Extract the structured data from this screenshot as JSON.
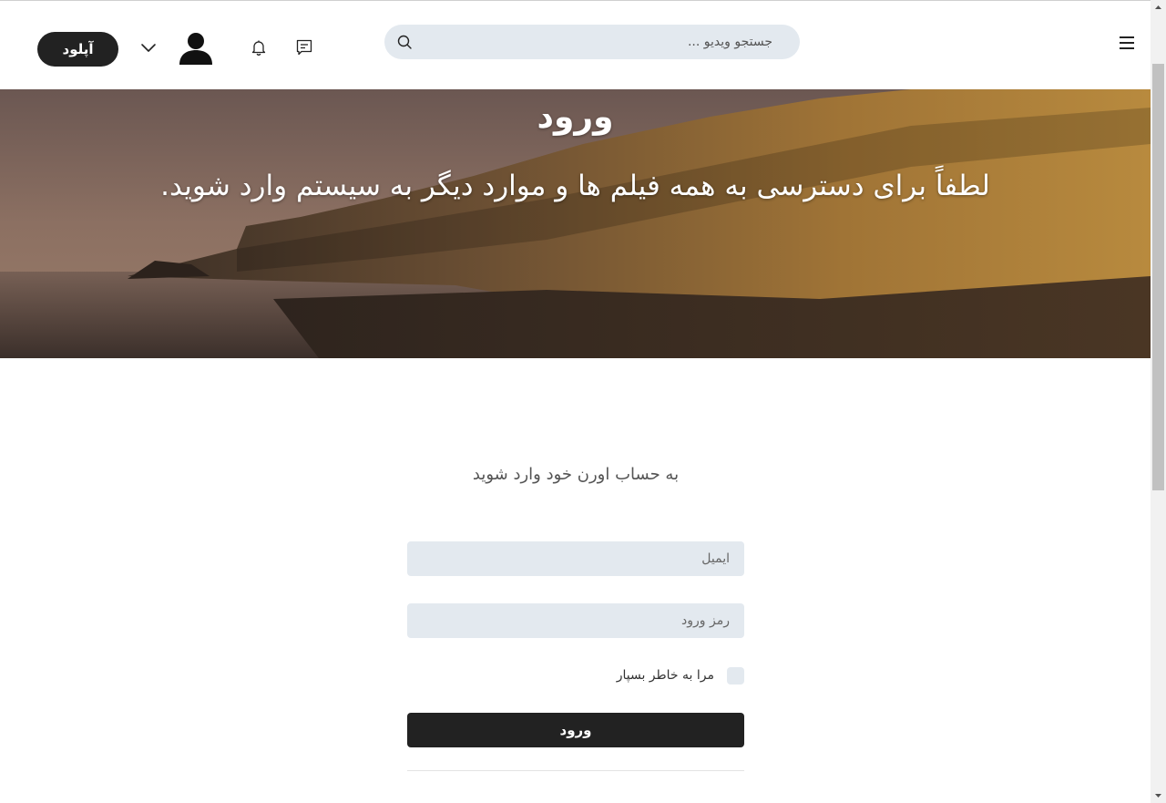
{
  "header": {
    "search_placeholder": "جستجو ویدیو ...",
    "upload_label": "آپلود",
    "icons": [
      "menu-icon",
      "search-icon",
      "message-icon",
      "bell-icon",
      "user-avatar-icon",
      "chevron-down-icon"
    ]
  },
  "hero": {
    "title": "ورود",
    "subtitle": "لطفاً برای دسترسی به همه فیلم ها و موارد دیگر به سیستم وارد شوید."
  },
  "login_form": {
    "heading": "به حساب اورن خود وارد شوید",
    "email_placeholder": "ایمیل",
    "password_placeholder": "رمز ورود",
    "remember_label": "مرا به خاطر بسپار",
    "submit_label": "ورود"
  },
  "colors": {
    "primary_dark": "#222222",
    "field_bg": "#e3e9ef"
  }
}
